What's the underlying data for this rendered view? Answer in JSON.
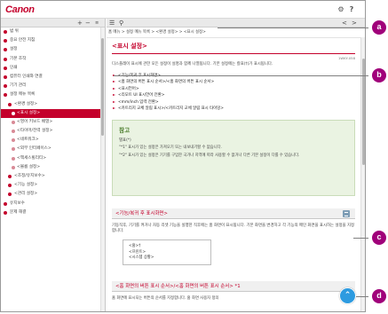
{
  "header": {
    "logo": "Canon",
    "help_icon": "gear-icon",
    "help_q": "?",
    "menu_icon": "menu-icon"
  },
  "sidebar": {
    "toolbar": {
      "collapse_all": "+",
      "expand_all": "−",
      "scroll_icon": "scroll-icon"
    },
    "items": [
      {
        "label": "범 위",
        "level": 0
      },
      {
        "label": "중요 안전 지침",
        "level": 0
      },
      {
        "label": "설정",
        "level": 0
      },
      {
        "label": "기본 조작",
        "level": 0
      },
      {
        "label": "인쇄",
        "level": 0
      },
      {
        "label": "컴퓨터 인쇄와 연결",
        "level": 0
      },
      {
        "label": "기기 관리",
        "level": 0
      },
      {
        "label": "설정 메뉴 목록",
        "level": 0
      },
      {
        "label": "<환경 설정>",
        "level": 1
      },
      {
        "label": "<표시 설정>",
        "level": 2,
        "selected": true
      },
      {
        "label": "<영어 키보드 배열>",
        "level": 2
      },
      {
        "label": "<타이머/전력 설정>",
        "level": 2
      },
      {
        "label": "<네트워크>",
        "level": 2
      },
      {
        "label": "<외부 인터페이스>",
        "level": 2
      },
      {
        "label": "<액세스빌리티>",
        "level": 2
      },
      {
        "label": "<볼륨 설정>",
        "level": 2
      },
      {
        "label": "<조정/유지보수>",
        "level": 1
      },
      {
        "label": "<기능 설정>",
        "level": 1
      },
      {
        "label": "<관리 설정>",
        "level": 1
      },
      {
        "label": "유지보수",
        "level": 0
      },
      {
        "label": "문제 해결",
        "level": 0
      }
    ]
  },
  "main": {
    "toolbar": {
      "collapse_icon": "chevron-left-icon",
      "search_icon": "search-icon",
      "prev": "<",
      "next": ">"
    },
    "breadcrumb": "홈 메뉴 > 설정 메뉴 목록 > <환경 설정> > <표시 설정>",
    "title": "<표시 설정>",
    "page_id": "1WKY-058",
    "intro": "디스플레이 표시에 관한 모든 설정이 설명과 함께 나열됩니다. 기본 설정에는 칼표(†)가 표시됩니다.",
    "toc": [
      "<기능/복귀 후 표시화면>",
      "<홈 화면의 버튼 표시 순서>/<홈 화면의 버튼 표시 순서>",
      "<표시언어>",
      "<리모트 UI 표시언어 전환>",
      "<mm/inch 입력 전환>",
      "<카트리지 교체 알림 표시>/<카트리지 교체 알림 표시 타이밍>"
    ],
    "note": {
      "title": "참고",
      "subtitle": "별표(*)",
      "lines": [
        "\"*1\" 표시가 있는 설정은 가져오기 또는 내보내기할 수 없습니다.",
        "\"*2\" 표시가 있는 설정은 기기를 구입한 국가나 지역에 따라 사용할 수 없거나 다른 기본 설정이 다를 수 있습니다."
      ]
    },
    "section1": {
      "heading": "<기능/복귀 후 표시화면>",
      "text": "기동직후, 기기를 켜거나 자동 리셋 기능을 실행한 직후에는 홈 화면이 표시됩니다. 기본 화면을 변경하고 각 기능의 메인 화면을 표시하는 설정을 지정합니다.",
      "options": [
        "<홈>†",
        "<프린트>",
        "<시스템 상황>"
      ]
    },
    "section2": {
      "heading": "<홈 화면의 버튼 표시 순서>/<홈 화면의 버튼 표시 순서> *1",
      "text": "홈 화면에 표시되는 버튼의 순서를 지정합니다. 홈 화면 사용자 정의"
    },
    "back_to_top": "⌃"
  },
  "callouts": [
    "a",
    "b",
    "c",
    "d"
  ],
  "colors": {
    "brand": "#c4002b",
    "callout": "#a0007a",
    "note_bg": "#eaf3e2",
    "top_button": "#2d9be0"
  }
}
